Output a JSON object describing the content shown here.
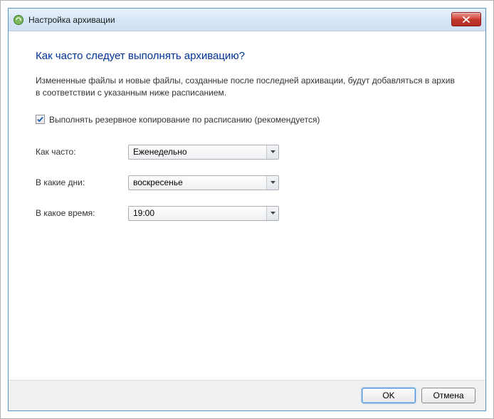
{
  "titlebar": {
    "title": "Настройка архивации"
  },
  "main": {
    "heading": "Как часто следует выполнять архивацию?",
    "description": "Измененные файлы и новые файлы, созданные после последней архивации, будут добавляться в архив в соответствии с указанным ниже расписанием.",
    "schedule_checkbox_label": "Выполнять резервное копирование по расписанию (рекомендуется)",
    "schedule_checked": true,
    "fields": {
      "frequency": {
        "label": "Как часто:",
        "value": "Еженедельно"
      },
      "day": {
        "label": "В какие дни:",
        "value": "воскресенье"
      },
      "time": {
        "label": "В какое время:",
        "value": "19:00"
      }
    }
  },
  "footer": {
    "ok_label": "OK",
    "cancel_label": "Отмена"
  }
}
